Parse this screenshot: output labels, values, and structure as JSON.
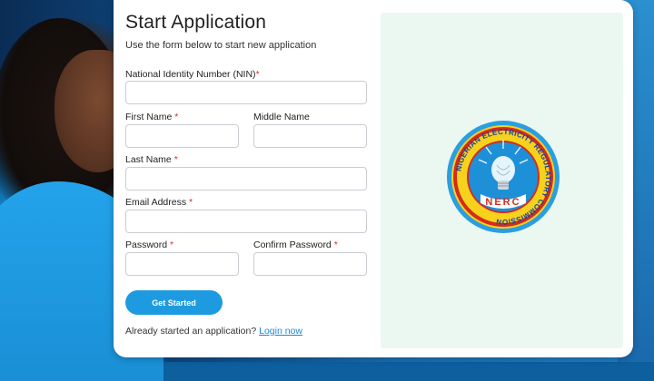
{
  "form": {
    "title": "Start Application",
    "subtitle": "Use the form below to start new application",
    "fields": {
      "nin": {
        "label": "National Identity Number (NIN)",
        "required_mark": "*",
        "value": "",
        "placeholder": ""
      },
      "first_name": {
        "label": "First Name",
        "required_mark": "*",
        "value": "",
        "placeholder": ""
      },
      "middle_name": {
        "label": "Middle Name",
        "value": "",
        "placeholder": ""
      },
      "last_name": {
        "label": "Last Name",
        "required_mark": "*",
        "value": "",
        "placeholder": ""
      },
      "email": {
        "label": "Email Address",
        "required_mark": "*",
        "value": "",
        "placeholder": ""
      },
      "password": {
        "label": "Password",
        "required_mark": "*",
        "value": "",
        "placeholder": ""
      },
      "confirm_password": {
        "label": "Confirm Password",
        "required_mark": "*",
        "value": "",
        "placeholder": ""
      }
    },
    "submit_label": "Get Started",
    "login_prompt": "Already started an application?",
    "login_link": "Login now"
  },
  "logo": {
    "icon": "nerc-logo",
    "ring_text": "NIGERIAN ELECTRICITY REGULATORY COMMISSION",
    "acronym": "NERC"
  },
  "colors": {
    "accent": "#1e9be0",
    "required": "#d32f2f",
    "link": "#1e88d6",
    "panel": "#eaf8f1"
  }
}
